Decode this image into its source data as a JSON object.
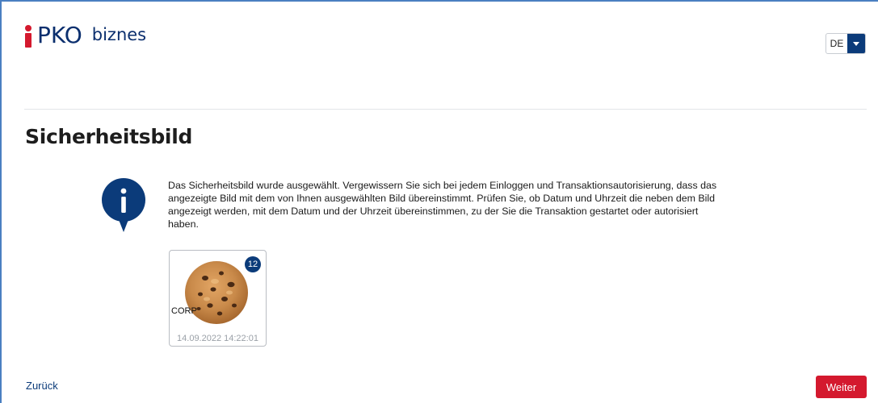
{
  "header": {
    "logo_pko": "PKO",
    "logo_biznes": "biznes",
    "language": {
      "selected": "DE"
    }
  },
  "page": {
    "title": "Sicherheitsbild"
  },
  "info": {
    "icon": "info-icon",
    "message": "Das Sicherheitsbild wurde ausgewählt. Vergewissern Sie sich bei jedem Einloggen und Transaktionsautorisierung, dass das angezeigte Bild mit dem von Ihnen ausgewählten Bild übereinstimmt. Prüfen Sie, ob Datum und Uhrzeit die neben dem Bild angezeigt werden, mit dem Datum und der Uhrzeit übereinstimmen, zu der Sie die Transaktion gestartet oder autorisiert haben."
  },
  "security_image": {
    "image": "cookie-image",
    "count": "12",
    "label": "CORP",
    "datetime": "14.09.2022 14:22:01"
  },
  "actions": {
    "back_label": "Zurück",
    "next_label": "Weiter"
  },
  "colors": {
    "brand_navy": "#0b3b7a",
    "brand_red": "#d4192e"
  }
}
